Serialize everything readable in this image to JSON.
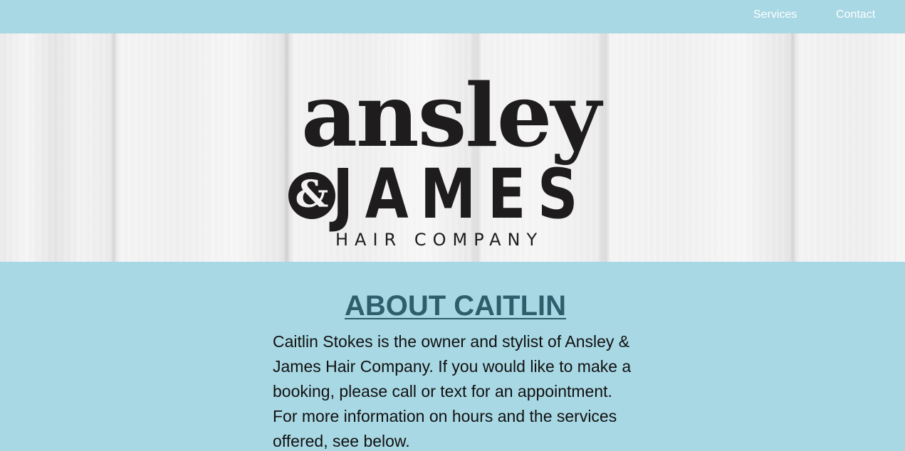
{
  "nav": {
    "services_label": "Services",
    "contact_label": "Contact"
  },
  "logo": {
    "line1": "ansley",
    "ampersand": "&",
    "line2": "JAMES",
    "line3": "HAIR COMPANY"
  },
  "about": {
    "title": "ABOUT CAITLIN",
    "body": "Caitlin Stokes is the owner and stylist of Ansley & James Hair Company. If you would like to make a booking, please call or text for an appointment. For more information on hours and the services offered, see below."
  },
  "colors": {
    "background": "#a8d8e4",
    "nav_text": "#ffffff",
    "title": "#2c5f6b",
    "logo_ink": "#1e1c1c"
  }
}
